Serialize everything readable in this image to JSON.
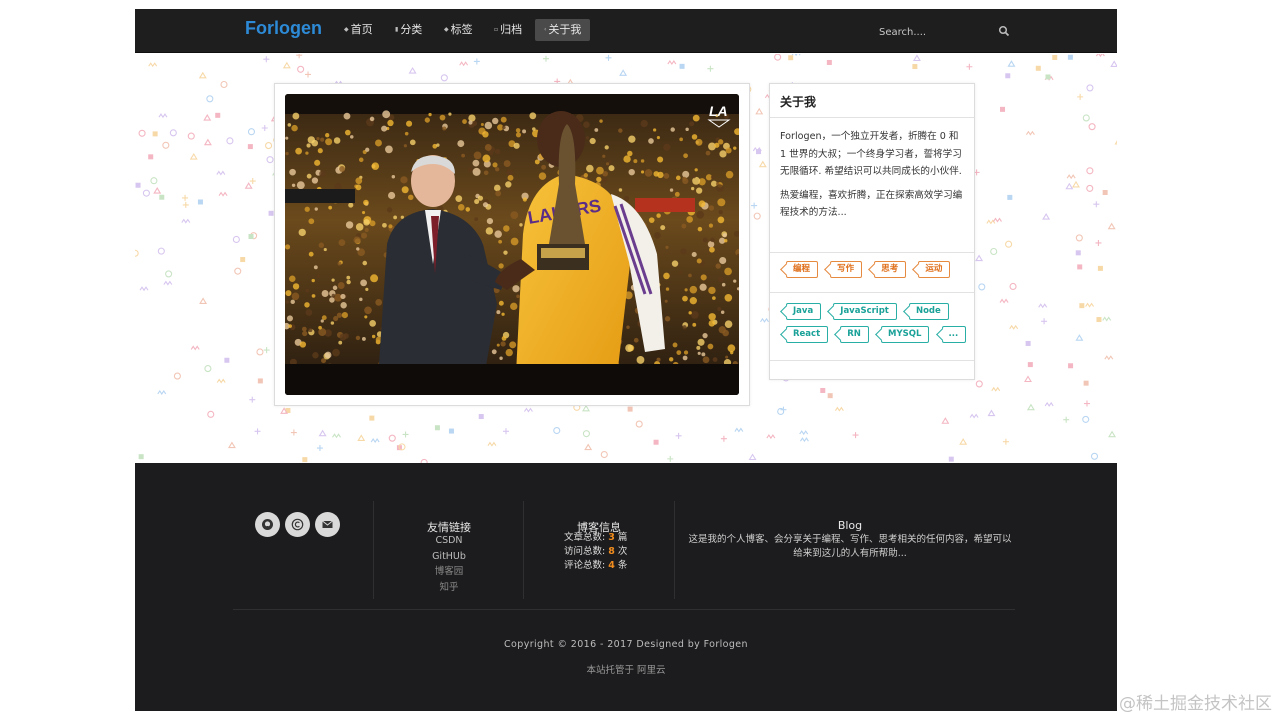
{
  "brand": "Forlogen",
  "nav": [
    {
      "label": "首页",
      "icon": "home-icon"
    },
    {
      "label": "分类",
      "icon": "folder-icon"
    },
    {
      "label": "标签",
      "icon": "tag-icon"
    },
    {
      "label": "归档",
      "icon": "archive-icon"
    },
    {
      "label": "关于我",
      "icon": "user-icon",
      "active": true
    }
  ],
  "search": {
    "placeholder": "Search...."
  },
  "about": {
    "title": "关于我",
    "para1": "Forlogen，一个独立开发者，折腾在 0 和 1 世界的大叔；一个终身学习者，誓将学习无限循环. 希望结识可以共同成长的小伙伴.",
    "para2": "热爱编程，喜欢折腾，正在探索高效学习编程技术的方法...",
    "interests": [
      "编程",
      "写作",
      "思考",
      "运动"
    ],
    "skills": [
      "Java",
      "JavaScript",
      "Node",
      "React",
      "RN",
      "MYSQL",
      "..."
    ]
  },
  "footer": {
    "social": [
      {
        "icon": "github-icon"
      },
      {
        "icon": "copyright-icon"
      },
      {
        "icon": "mail-icon"
      }
    ],
    "links_title": "友情链接",
    "links": [
      "CSDN",
      "GitHUb",
      "博客园",
      "知乎"
    ],
    "info_title": "博客信息",
    "stats": [
      {
        "label": "文章总数:",
        "value": "3",
        "unit": "篇"
      },
      {
        "label": "访问总数:",
        "value": "8",
        "unit": "次"
      },
      {
        "label": "评论总数:",
        "value": "4",
        "unit": "条"
      }
    ],
    "blog_title": "Blog",
    "blog_desc": "这是我的个人博客、会分享关于编程、写作、思考相关的任何内容，希望可以给来到这儿的人有所帮助...",
    "copyright": "Copyright © 2016 - 2017 Designed by Forlogen",
    "hosted_prefix": "本站托管于",
    "hosted_link": "阿里云"
  },
  "watermark": "@稀土掘金技术社区",
  "colors": {
    "brand": "#2d8ad6",
    "accent_orange": "#e0701c",
    "accent_teal": "#1aa198",
    "footer_bg": "#1c1c1e",
    "nav_bg": "#1e1e1e"
  }
}
